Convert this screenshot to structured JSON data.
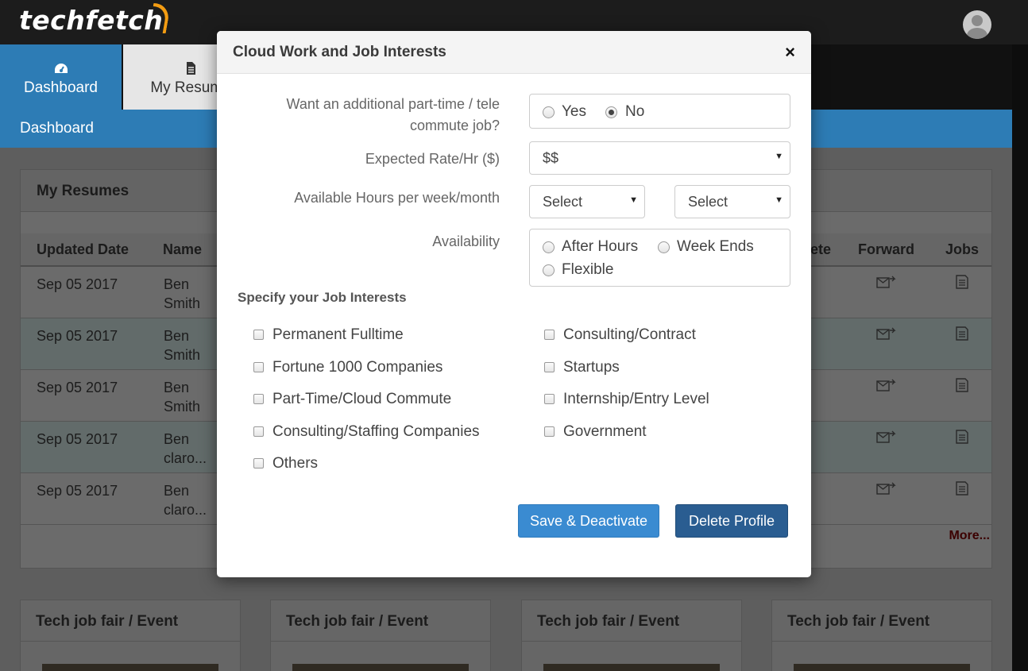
{
  "header": {
    "logo_text": "techfetch",
    "accent_color": "#f39c12"
  },
  "nav": {
    "tabs": [
      {
        "label": "Dashboard",
        "icon": "dashboard-icon"
      },
      {
        "label": "My Resume",
        "icon": "document-icon"
      }
    ],
    "breadcrumb": "Dashboard"
  },
  "resumes_panel": {
    "title": "My Resumes",
    "columns": [
      "Updated Date",
      "Name",
      "ete",
      "Forward",
      "Jobs"
    ],
    "rows": [
      {
        "date": "Sep 05 2017",
        "name_line1": "Ben",
        "name_line2": "Smith"
      },
      {
        "date": "Sep 05 2017",
        "name_line1": "Ben",
        "name_line2": "Smith"
      },
      {
        "date": "Sep 05 2017",
        "name_line1": "Ben",
        "name_line2": "Smith"
      },
      {
        "date": "Sep 05 2017",
        "name_line1": "Ben",
        "name_line2": "claro..."
      },
      {
        "date": "Sep 05 2017",
        "name_line1": "Ben",
        "name_line2": "claro..."
      }
    ],
    "more_link": "More..."
  },
  "event_cards": [
    {
      "title": "Tech job fair / Event"
    },
    {
      "title": "Tech job fair / Event"
    },
    {
      "title": "Tech job fair / Event"
    },
    {
      "title": "Tech job fair / Event"
    }
  ],
  "modal": {
    "title": "Cloud Work and Job Interests",
    "close_glyph": "×",
    "part_time": {
      "label_line1": "Want an additional part-time / tele",
      "label_line2": "commute job?",
      "options": [
        "Yes",
        "No"
      ],
      "selected": "No"
    },
    "rate": {
      "label": "Expected Rate/Hr ($)",
      "value": "$$"
    },
    "hours": {
      "label": "Available Hours per week/month",
      "select1": "Select",
      "select2": "Select"
    },
    "availability": {
      "label": "Availability",
      "options": [
        "After Hours",
        "Week Ends",
        "Flexible"
      ]
    },
    "interests": {
      "title": "Specify your Job Interests",
      "left": [
        "Permanent Fulltime",
        "Fortune 1000 Companies",
        "Part-Time/Cloud Commute",
        "Consulting/Staffing Companies",
        "Others"
      ],
      "right": [
        "Consulting/Contract",
        "Startups",
        "Internship/Entry Level",
        "Government"
      ]
    },
    "buttons": {
      "save": "Save & Deactivate",
      "delete": "Delete Profile"
    }
  }
}
